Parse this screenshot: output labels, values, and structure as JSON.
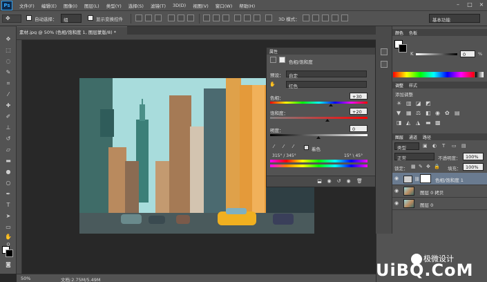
{
  "menu": {
    "logo": "Ps",
    "items": [
      "文件(F)",
      "编辑(E)",
      "图像(I)",
      "图层(L)",
      "类型(Y)",
      "选择(S)",
      "滤镜(T)",
      "3D(D)",
      "视图(V)",
      "窗口(W)",
      "帮助(H)"
    ],
    "window_controls": [
      "–",
      "□",
      "×"
    ]
  },
  "options": {
    "auto_select_label": "自动选择：",
    "auto_select_value": "组",
    "show_transform_label": "显示变换控件",
    "mode_3d_label": "3D 模式：",
    "workspace": "基本功能"
  },
  "document": {
    "tab_title": "素材.jpg @ 50% (色相/饱和度 1, 图层蒙版/8) *",
    "zoom": "50%",
    "doc_info": "文档:2.75M/5.49M"
  },
  "properties": {
    "panel_title": "属性",
    "layer_type": "色相/饱和度",
    "preset_label": "预设：",
    "preset_value": "自定",
    "channel_value": "红色",
    "hue_label": "色相：",
    "hue_value": "+30",
    "saturation_label": "饱和度：",
    "saturation_value": "+20",
    "lightness_label": "明度：",
    "lightness_value": "0",
    "colorize_label": "着色",
    "range_left": "315° / 345°",
    "range_right": "15° \\ 45°"
  },
  "color_panel": {
    "tabs": [
      "颜色",
      "色板"
    ],
    "k_label": "K",
    "k_value": "0",
    "k_unit": "%"
  },
  "adjustments_panel": {
    "tabs": [
      "调整",
      "样式"
    ],
    "heading": "添加调整"
  },
  "layers_panel": {
    "tabs": [
      "图层",
      "通道",
      "路径"
    ],
    "filter_kind": "类型",
    "blend_mode": "正常",
    "opacity_label": "不透明度：",
    "opacity_value": "100%",
    "lock_label": "锁定：",
    "fill_label": "填充：",
    "fill_value": "100%",
    "layers": [
      {
        "name": "色相/饱和度 1",
        "selected": true
      },
      {
        "name": "图层 0 拷贝",
        "selected": false
      },
      {
        "name": "图层 0",
        "selected": false
      }
    ]
  },
  "watermark": {
    "brand": "极微设计",
    "site": "UiBQ.CoM"
  },
  "colors": {
    "ui_bg": "#535353",
    "canvas_bg": "#282828",
    "selected_layer": "#6a7b90",
    "accent_blue": "#31a8ff",
    "taxi_yellow": "#f0b020"
  }
}
